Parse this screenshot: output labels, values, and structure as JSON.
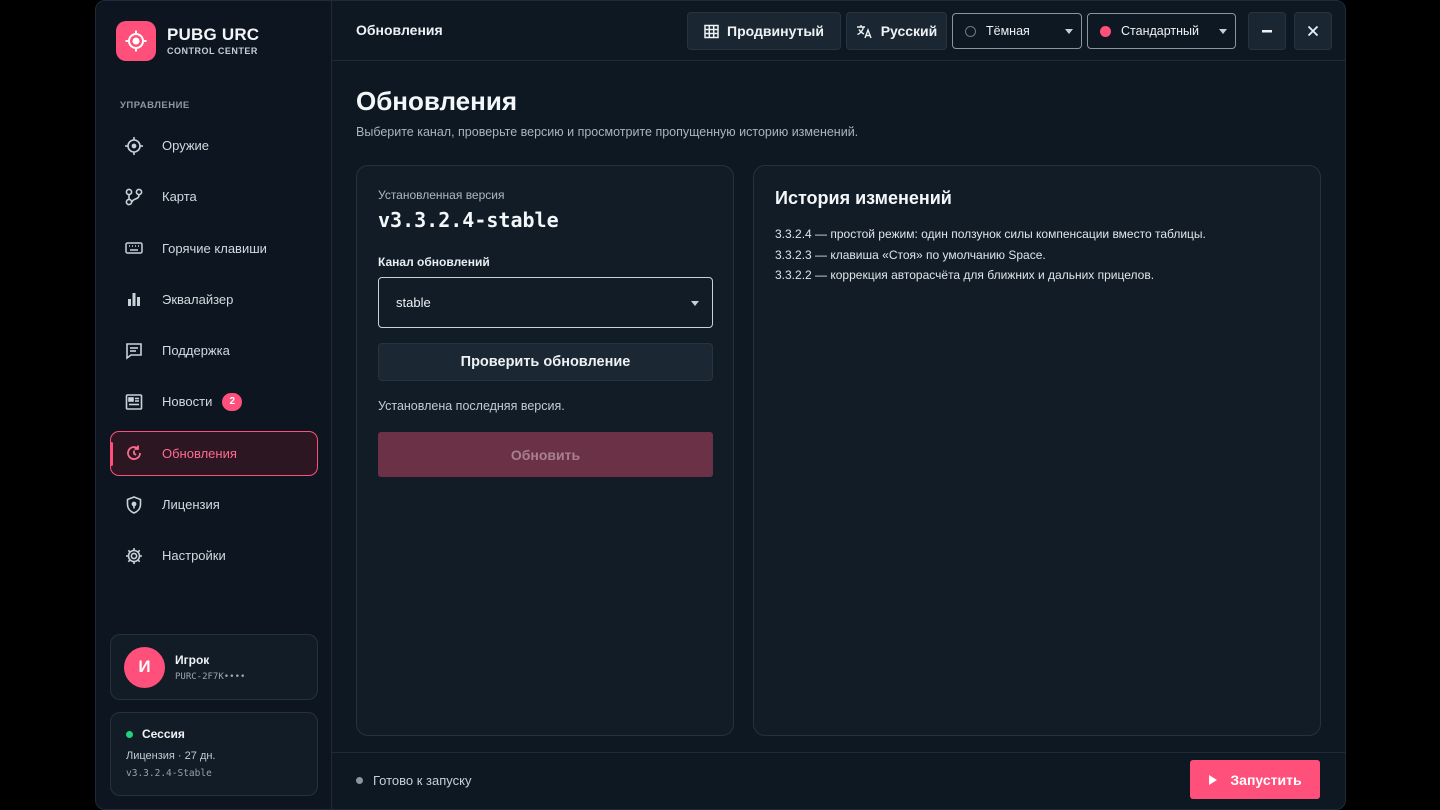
{
  "brand": {
    "title": "PUBG URC",
    "subtitle": "CONTROL CENTER"
  },
  "sidebar": {
    "section": "УПРАВЛЕНИЕ",
    "items": [
      {
        "label": "Оружие",
        "icon": "crosshair-icon"
      },
      {
        "label": "Карта",
        "icon": "map-route-icon"
      },
      {
        "label": "Горячие клавиши",
        "icon": "keyboard-icon"
      },
      {
        "label": "Эквалайзер",
        "icon": "bar-chart-icon"
      },
      {
        "label": "Поддержка",
        "icon": "chat-icon"
      },
      {
        "label": "Новости",
        "icon": "newspaper-icon",
        "badge": "2"
      },
      {
        "label": "Обновления",
        "icon": "refresh-icon",
        "active": true
      },
      {
        "label": "Лицензия",
        "icon": "shield-icon"
      },
      {
        "label": "Настройки",
        "icon": "gear-icon"
      }
    ]
  },
  "user": {
    "initial": "И",
    "name": "Игрок",
    "id": "PURC-2F7K••••"
  },
  "session": {
    "title": "Сессия",
    "license": "Лицензия · 27 дн.",
    "version": "v3.3.2.4-Stable"
  },
  "header": {
    "title": "Обновления",
    "mode_btn": "Продвинутый",
    "lang_btn": "Русский",
    "theme_select": "Тёмная",
    "preset_select": "Стандартный",
    "minimize": "−",
    "close": "×"
  },
  "main": {
    "title": "Обновления",
    "subtitle": "Выберите канал, проверьте версию и просмотрите пропущенную историю изменений.",
    "installed_label": "Установленная версия",
    "installed_version": "v3.3.2.4-stable",
    "channel_label": "Канал обновлений",
    "channel_value": "stable",
    "check_button": "Проверить обновление",
    "status": "Установлена последняя версия.",
    "update_button": "Обновить",
    "history_title": "История изменений",
    "history": [
      "3.3.2.4 — простой режим: один ползунок силы компенсации вместо таблицы.",
      "3.3.2.3 — клавиша «Стоя» по умолчанию Space.",
      "3.3.2.2 — коррекция авторасчёта для ближних и дальних прицелов."
    ]
  },
  "footer": {
    "status": "Готово к запуску",
    "launch": "Запустить"
  },
  "colors": {
    "accent": "#ff4f7b",
    "session_dot": "#22d17a",
    "bg": "#0e1822"
  }
}
